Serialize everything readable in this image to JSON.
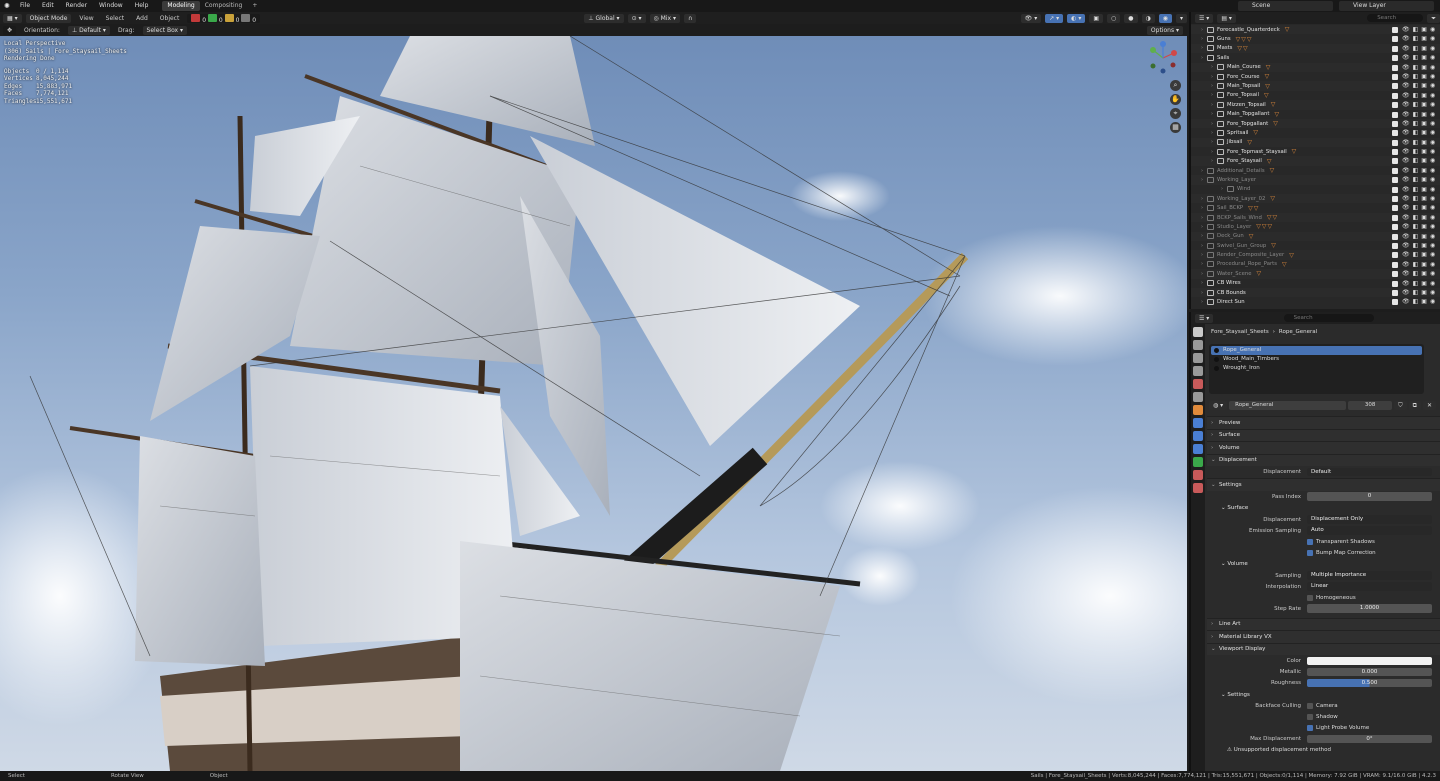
{
  "topbar": {
    "menus": [
      "File",
      "Edit",
      "Render",
      "Window",
      "Help"
    ],
    "workspaces": [
      {
        "label": "Modeling",
        "active": true
      },
      {
        "label": "Compositing",
        "active": false
      }
    ],
    "add_tab": "+",
    "scene": "Scene",
    "view_layer": "View Layer"
  },
  "viewport_header": {
    "mode": "Object Mode",
    "menus": [
      "View",
      "Select",
      "Add",
      "Object"
    ],
    "counters": [
      "0",
      "0",
      "0",
      "0"
    ],
    "transform": "Global",
    "pivot_label": "Mix",
    "orientation_label": "Orientation:",
    "orientation_value": "Default",
    "drag_label": "Drag:",
    "drag_value": "Select Box",
    "options": "Options"
  },
  "overlay": {
    "lines": [
      "Local Perspective",
      "(306) Sails | Fore_Staysail_Sheets",
      "Rendering Done"
    ],
    "stats": [
      {
        "label": "Objects",
        "value": "0 / 1,114"
      },
      {
        "label": "Vertices",
        "value": "8,045,244"
      },
      {
        "label": "Edges",
        "value": "15,883,971"
      },
      {
        "label": "Faces",
        "value": "7,774,121"
      },
      {
        "label": "Triangles",
        "value": "15,551,671"
      }
    ]
  },
  "outliner": {
    "search_placeholder": "Search",
    "rows": [
      {
        "name": "Forecastle_Quarterdeck",
        "badges": "▽",
        "dim": false,
        "indent": 0
      },
      {
        "name": "Guns",
        "badges": "▽▽▽",
        "dim": false,
        "indent": 0
      },
      {
        "name": "Masts",
        "badges": "▽▽",
        "dim": false,
        "indent": 0
      },
      {
        "name": "Sails",
        "badges": "",
        "dim": false,
        "indent": 0
      },
      {
        "name": "Main_Course",
        "badges": "▽",
        "dim": false,
        "indent": 1
      },
      {
        "name": "Fore_Course",
        "badges": "▽",
        "dim": false,
        "indent": 1
      },
      {
        "name": "Main_Topsail",
        "badges": "▽",
        "dim": false,
        "indent": 1
      },
      {
        "name": "Fore_Topsail",
        "badges": "▽",
        "dim": false,
        "indent": 1
      },
      {
        "name": "Mizzen_Topsail",
        "badges": "▽",
        "dim": false,
        "indent": 1
      },
      {
        "name": "Main_Topgallant",
        "badges": "▽",
        "dim": false,
        "indent": 1
      },
      {
        "name": "Fore_Topgallant",
        "badges": "▽",
        "dim": false,
        "indent": 1
      },
      {
        "name": "Spritsail",
        "badges": "▽",
        "dim": false,
        "indent": 1
      },
      {
        "name": "Jibsail",
        "badges": "▽",
        "dim": false,
        "indent": 1
      },
      {
        "name": "Fore_Topmast_Staysail",
        "badges": "▽",
        "dim": false,
        "indent": 1
      },
      {
        "name": "Fore_Staysail",
        "badges": "▽",
        "dim": false,
        "indent": 1
      },
      {
        "name": "Additional_Details",
        "badges": "▽",
        "dim": true,
        "indent": 0
      },
      {
        "name": "Working_Layer",
        "badges": "",
        "dim": true,
        "indent": 0
      },
      {
        "name": "Wind",
        "badges": "",
        "dim": true,
        "indent": 2
      },
      {
        "name": "Working_Layer_02",
        "badges": "▽",
        "dim": true,
        "indent": 0
      },
      {
        "name": "Sail_BCKP",
        "badges": "▽▽",
        "dim": true,
        "indent": 0
      },
      {
        "name": "BCKP_Sails_Wind",
        "badges": "▽▽",
        "dim": true,
        "indent": 0
      },
      {
        "name": "Studio_Layer",
        "badges": "▽▽▽",
        "dim": true,
        "indent": 0
      },
      {
        "name": "Deck_Gun",
        "badges": "▽",
        "dim": true,
        "indent": 0
      },
      {
        "name": "Swivel_Gun_Group",
        "badges": "▽",
        "dim": true,
        "indent": 0
      },
      {
        "name": "Render_Composite_Layer",
        "badges": "▽",
        "dim": true,
        "indent": 0
      },
      {
        "name": "Procedural_Rope_Parts",
        "badges": "▽",
        "dim": true,
        "indent": 0
      },
      {
        "name": "Water_Scene",
        "badges": "▽",
        "dim": true,
        "indent": 0
      },
      {
        "name": "CB Wires",
        "badges": "",
        "dim": false,
        "indent": 0
      },
      {
        "name": "CB Bounds",
        "badges": "",
        "dim": false,
        "indent": 0
      },
      {
        "name": "Direct Sun",
        "badges": "",
        "dim": false,
        "indent": 0
      }
    ]
  },
  "properties": {
    "search_placeholder": "Search",
    "breadcrumb": [
      "Fore_Staysail_Sheets",
      "Rope_General"
    ],
    "slots": [
      {
        "name": "Rope_General",
        "selected": true
      },
      {
        "name": "Wood_Main_Timbers",
        "selected": false
      },
      {
        "name": "Wrought_Iron",
        "selected": false
      }
    ],
    "material_name": "Rope_General",
    "user_count": "308",
    "panels": {
      "preview": "Preview",
      "surface": "Surface",
      "volume": "Volume",
      "displacement": "Displacement",
      "displacement_label": "Displacement",
      "displacement_value": "Default",
      "settings": "Settings",
      "pass_index_label": "Pass Index",
      "pass_index": "0",
      "surface_sub": "Surface",
      "disp_method_label": "Displacement",
      "disp_method": "Displacement Only",
      "emission_label": "Emission Sampling",
      "emission": "Auto",
      "transparent_shadows": "Transparent Shadows",
      "bump_map": "Bump Map Correction",
      "volume_sub": "Volume",
      "sampling_label": "Sampling",
      "sampling": "Multiple Importance",
      "interp_label": "Interpolation",
      "interp": "Linear",
      "homogeneous": "Homogeneous",
      "step_rate_label": "Step Rate",
      "step_rate": "1.0000",
      "line_art": "Line Art",
      "material_library": "Material Library VX",
      "viewport_display": "Viewport Display",
      "color_label": "Color",
      "metallic_label": "Metallic",
      "metallic": "0.000",
      "roughness_label": "Roughness",
      "roughness": "0.500",
      "vd_settings": "Settings",
      "backface_label": "Backface Culling",
      "camera": "Camera",
      "shadow": "Shadow",
      "light_probe": "Light Probe Volume",
      "max_disp_label": "Max Displacement",
      "max_disp": "0°",
      "warning": "Unsupported displacement method"
    }
  },
  "statusbar": {
    "select": "Select",
    "rotate": "Rotate View",
    "object": "Object",
    "stats": "Sails | Fore_Staysail_Sheets | Verts:8,045,244 | Faces:7,774,121 | Tris:15,551,671 | Objects:0/1,114 | Memory: 7.92 GiB | VRAM: 9.1/16.0 GiB | 4.2.3"
  },
  "colors": {
    "accent": "#4772b3",
    "badge": "#e08a3b",
    "sky": "#8aa5c9"
  }
}
